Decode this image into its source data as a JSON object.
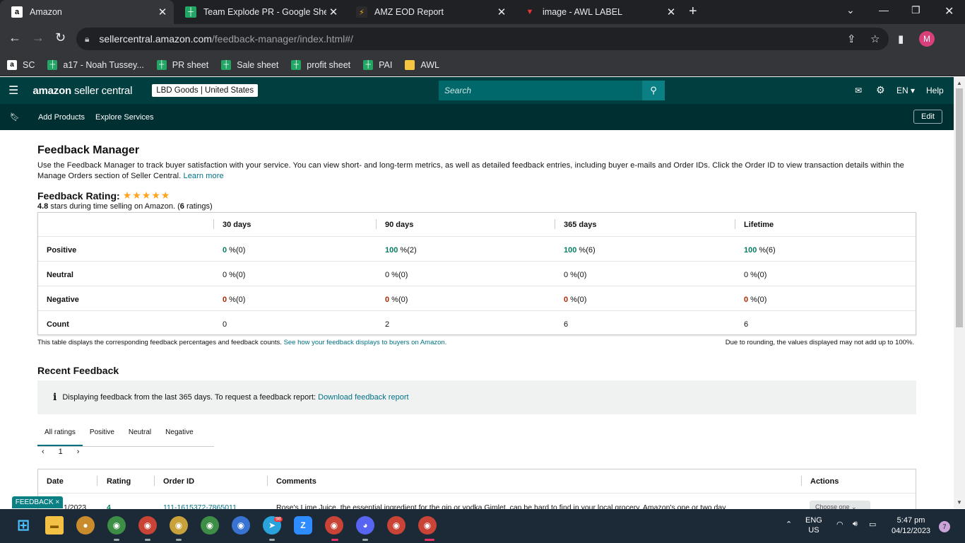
{
  "browser": {
    "tabs": [
      {
        "title": "Amazon",
        "icon": "amazon-favicon",
        "active": true
      },
      {
        "title": "Team Explode PR - Google Sheet",
        "icon": "sheets-icon"
      },
      {
        "title": "AMZ EOD Report",
        "icon": "report-icon"
      },
      {
        "title": "image - AWL LABEL",
        "icon": "image-icon"
      }
    ],
    "url_host": "sellercentral.amazon.com",
    "url_path": "/feedback-manager/index.html#/",
    "profile_initial": "M",
    "bookmarks": [
      {
        "label": "SC",
        "icon": "amazon-icon"
      },
      {
        "label": "a17 - Noah Tussey...",
        "icon": "sheets-icon"
      },
      {
        "label": "PR sheet",
        "icon": "sheets-icon"
      },
      {
        "label": "Sale sheet",
        "icon": "sheets-icon"
      },
      {
        "label": "profit sheet",
        "icon": "sheets-icon"
      },
      {
        "label": "PAI",
        "icon": "sheets-icon"
      },
      {
        "label": "AWL",
        "icon": "folder-icon"
      }
    ]
  },
  "sc": {
    "logo_main": "amazon",
    "logo_sub": "seller central",
    "store": "LBD Goods | United States",
    "search_placeholder": "Search",
    "lang": "EN",
    "help": "Help",
    "subnav": [
      "Add Products",
      "Explore Services"
    ],
    "edit": "Edit"
  },
  "page": {
    "title": "Feedback Manager",
    "description": "Use the Feedback Manager to track buyer satisfaction with your service. You can view short- and long-term metrics, as well as detailed feedback entries, including buyer e-mails and Order IDs. Click the Order ID to view transaction details within the Manage Orders section of Seller Central.",
    "learn_more": "Learn more",
    "rating_title": "Feedback Rating:",
    "rating_stars": 5,
    "rating_value": "4.8",
    "rating_text": "stars during time selling on Amazon. (",
    "rating_count": "6",
    "rating_count_suffix": "ratings)",
    "table": {
      "columns": [
        "30 days",
        "90 days",
        "365 days",
        "Lifetime"
      ],
      "rows": [
        {
          "label": "Positive",
          "class": "green",
          "cells": [
            [
              "0",
              " %(0)"
            ],
            [
              "100",
              " %(2)"
            ],
            [
              "100",
              " %(6)"
            ],
            [
              "100",
              " %(6)"
            ]
          ]
        },
        {
          "label": "Neutral",
          "class": "",
          "cells": [
            [
              "0",
              " %(0)"
            ],
            [
              "0",
              " %(0)"
            ],
            [
              "0",
              " %(0)"
            ],
            [
              "0",
              " %(0)"
            ]
          ]
        },
        {
          "label": "Negative",
          "class": "red",
          "cells": [
            [
              "0",
              " %(0)"
            ],
            [
              "0",
              " %(0)"
            ],
            [
              "0",
              " %(0)"
            ],
            [
              "0",
              " %(0)"
            ]
          ]
        },
        {
          "label": "Count",
          "class": "",
          "cells": [
            [
              "0",
              ""
            ],
            [
              "2",
              ""
            ],
            [
              "6",
              ""
            ],
            [
              "6",
              ""
            ]
          ]
        }
      ]
    },
    "note_text": "This table displays the corresponding feedback percentages and feedback counts.",
    "note_link": "See how your feedback displays to buyers on Amazon.",
    "note_right": "Due to rounding, the values displayed may not add up to 100%.",
    "recent_title": "Recent Feedback",
    "info_text": "Displaying feedback from the last 365 days. To request a feedback report:",
    "info_link": "Download feedback report",
    "filter_tabs": [
      "All ratings",
      "Positive",
      "Neutral",
      "Negative"
    ],
    "page_number": "1",
    "recent_columns": [
      "Date",
      "Rating",
      "Order ID",
      "Comments",
      "Actions"
    ],
    "recent_rows": [
      {
        "date": "1/2023",
        "rating": "4",
        "order_id": "111-1615372-7865011",
        "comment": "Rose's Lime Juice, the essential ingredient for the gin or vodka Gimlet, can be hard to find in your local grocery. Amazon's one or two day",
        "action": "Choose one"
      }
    ],
    "feedback_button": "FEEDBACK ×"
  },
  "taskbar": {
    "lang": "ENG",
    "region": "US",
    "time": "5:47 pm",
    "date": "04/12/2023",
    "notifications": "7",
    "telegram_badge": "98"
  },
  "colors": {
    "header": "#003e3f",
    "accent": "#007185",
    "star": "#ffa41c",
    "positive": "#067d62",
    "negative": "#b12704"
  }
}
